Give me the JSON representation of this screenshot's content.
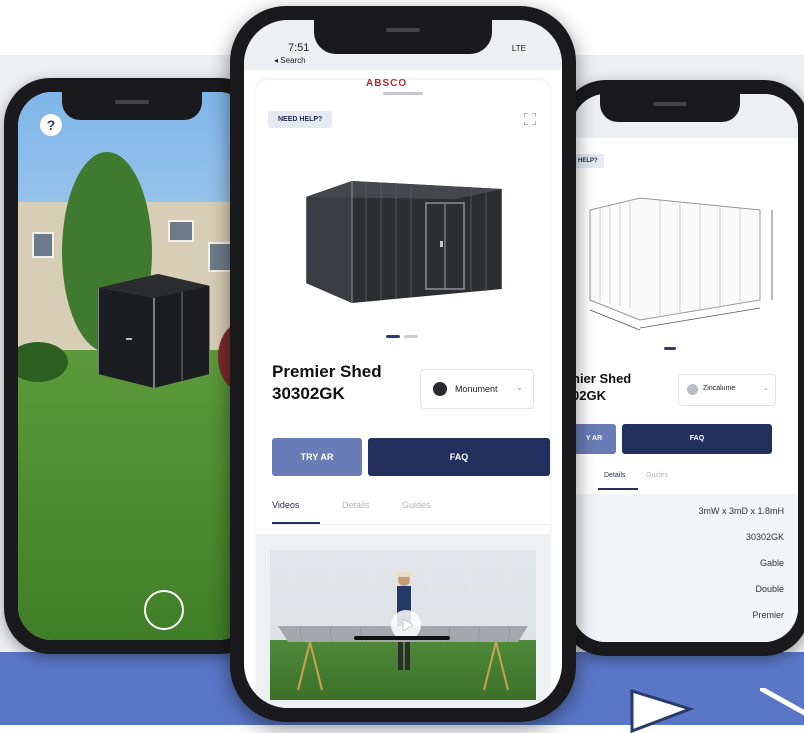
{
  "left_phone": {
    "help_glyph": "?"
  },
  "middle_phone": {
    "status": {
      "time": "7:51",
      "back": "◂ Search",
      "network": "LTE"
    },
    "brand": "ABSCO",
    "need_help": "NEED HELP?",
    "product_title_line1": "Premier Shed",
    "product_title_line2": "30302GK",
    "color_option": "Monument",
    "try_ar_label": "TRY AR",
    "faq_label": "FAQ",
    "tabs": [
      {
        "label": "Videos"
      },
      {
        "label": "Details"
      },
      {
        "label": "Guides"
      }
    ]
  },
  "right_phone": {
    "need_help": "HELP?",
    "product_title_line1": "nier Shed",
    "product_title_line2": "02GK",
    "color_option": "Zincalume",
    "try_ar_label": "Y AR",
    "faq_label": "FAQ",
    "tabs": [
      {
        "label": "Details"
      },
      {
        "label": "Guides"
      }
    ],
    "details": [
      "3mW x 3mD x 1.8mH",
      "30302GK",
      "Gable",
      "Double",
      "Premier"
    ]
  },
  "colors": {
    "navy": "#232f5c",
    "periwinkle": "#6a7cb6",
    "band_blue": "#5a77c7",
    "brand_red": "#b3282d"
  }
}
